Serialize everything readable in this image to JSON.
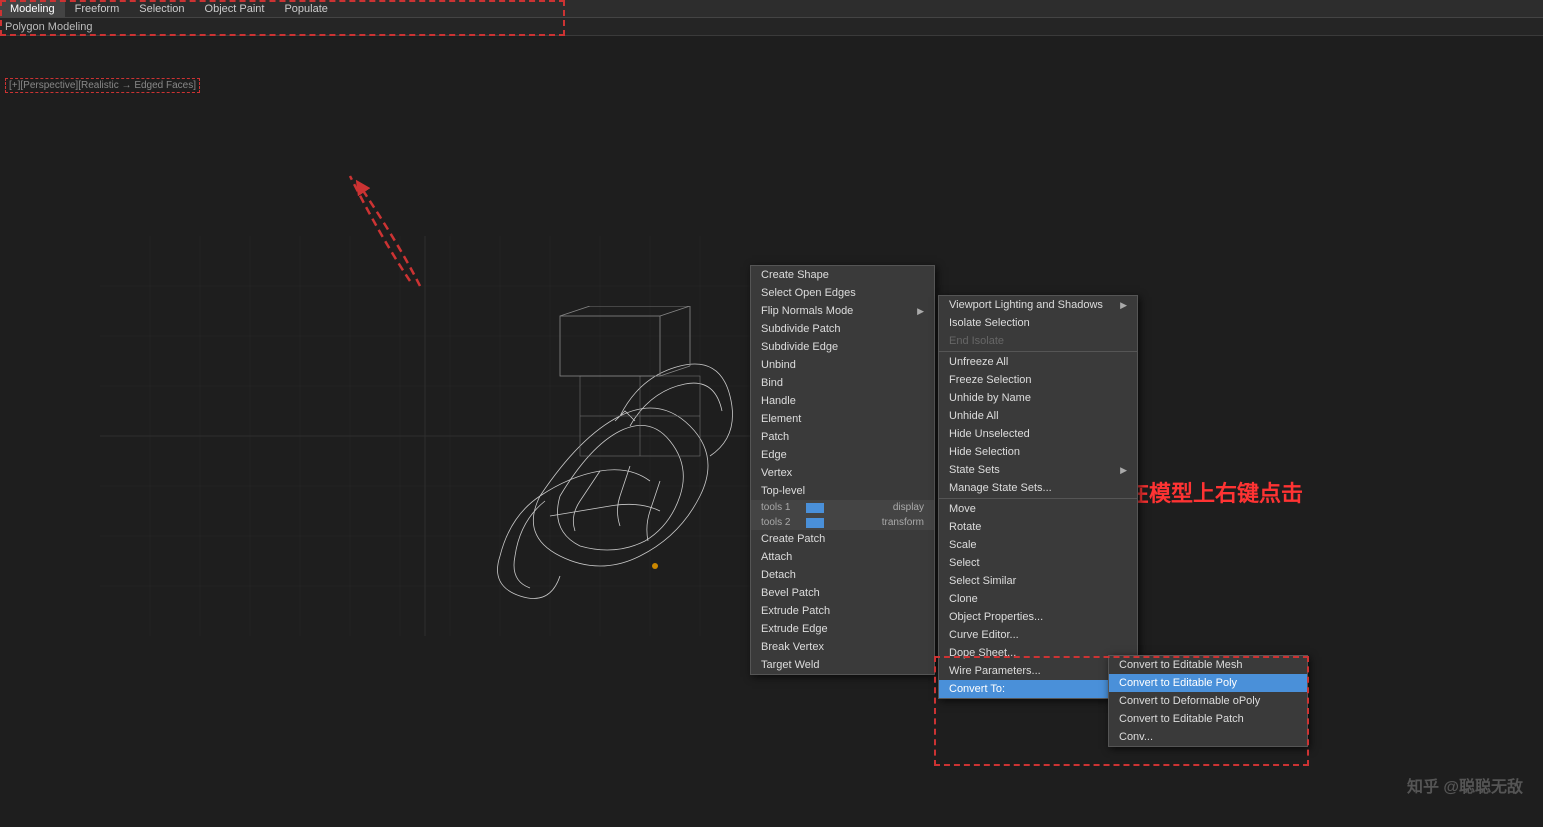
{
  "menubar": {
    "items": [
      "Modeling",
      "Freeform",
      "Selection",
      "Object Paint",
      "Populate"
    ],
    "polygon_label": "Polygon Modeling"
  },
  "viewport": {
    "label": "[+][Perspective][Realistic → Edged Faces]"
  },
  "annotation": {
    "text": "在模型上右键点击"
  },
  "watermark": "知乎 @聪聪无敌",
  "context_menu_left": {
    "items": [
      {
        "label": "Create Shape",
        "disabled": false,
        "arrow": false
      },
      {
        "label": "Select Open Edges",
        "disabled": false,
        "arrow": false
      },
      {
        "label": "Flip Normals Mode",
        "disabled": false,
        "arrow": true
      },
      {
        "label": "Subdivide Patch",
        "disabled": false,
        "arrow": false
      },
      {
        "label": "Subdivide Edge",
        "disabled": false,
        "arrow": false
      },
      {
        "label": "Unbind",
        "disabled": false,
        "arrow": false
      },
      {
        "label": "Bind",
        "disabled": false,
        "arrow": false
      },
      {
        "label": "Handle",
        "disabled": false,
        "arrow": false
      },
      {
        "label": "Element",
        "disabled": false,
        "arrow": false
      },
      {
        "label": "Patch",
        "disabled": false,
        "arrow": false
      },
      {
        "label": "Edge",
        "disabled": false,
        "arrow": false
      },
      {
        "label": "Vertex",
        "disabled": false,
        "arrow": false
      },
      {
        "label": "Top-level",
        "disabled": false,
        "arrow": false
      },
      {
        "label": "tools 1",
        "is_tools": true,
        "arrow": false
      },
      {
        "label": "tools 2",
        "is_tools": true,
        "arrow": false
      },
      {
        "label": "Create Patch",
        "disabled": false,
        "arrow": false
      },
      {
        "label": "Attach",
        "disabled": false,
        "arrow": false
      },
      {
        "label": "Detach",
        "disabled": false,
        "arrow": false
      },
      {
        "label": "Bevel Patch",
        "disabled": false,
        "arrow": false
      },
      {
        "label": "Extrude Patch",
        "disabled": false,
        "arrow": false
      },
      {
        "label": "Extrude Edge",
        "disabled": false,
        "arrow": false
      },
      {
        "label": "Break Vertex",
        "disabled": false,
        "arrow": false
      },
      {
        "label": "Target Weld",
        "disabled": false,
        "arrow": false
      }
    ]
  },
  "context_menu_right": {
    "items": [
      {
        "label": "Viewport Lighting and Shadows",
        "disabled": false,
        "arrow": true
      },
      {
        "label": "Isolate Selection",
        "disabled": false,
        "arrow": false
      },
      {
        "label": "End Isolate",
        "disabled": true,
        "arrow": false
      },
      {
        "label": "Unfreeze All",
        "disabled": false,
        "arrow": false
      },
      {
        "label": "Freeze Selection",
        "disabled": false,
        "arrow": false
      },
      {
        "label": "Unhide by Name",
        "disabled": false,
        "arrow": false
      },
      {
        "label": "Unhide All",
        "disabled": false,
        "arrow": false
      },
      {
        "label": "Hide Unselected",
        "disabled": false,
        "arrow": false
      },
      {
        "label": "Hide Selection",
        "disabled": false,
        "arrow": false
      },
      {
        "label": "State Sets",
        "disabled": false,
        "arrow": true
      },
      {
        "label": "Manage State Sets...",
        "disabled": false,
        "arrow": false
      },
      {
        "label": "separator",
        "is_sep": true
      },
      {
        "label": "Move",
        "disabled": false,
        "arrow": false
      },
      {
        "label": "Rotate",
        "disabled": false,
        "arrow": false
      },
      {
        "label": "Scale",
        "disabled": false,
        "arrow": false
      },
      {
        "label": "Select",
        "disabled": false,
        "arrow": false
      },
      {
        "label": "Select Similar",
        "disabled": false,
        "arrow": false
      },
      {
        "label": "Clone",
        "disabled": false,
        "arrow": false
      },
      {
        "label": "Object Properties...",
        "disabled": false,
        "arrow": false
      },
      {
        "label": "Curve Editor...",
        "disabled": false,
        "arrow": false
      },
      {
        "label": "Dope Sheet...",
        "disabled": false,
        "arrow": false
      },
      {
        "label": "Wire Parameters...",
        "disabled": false,
        "arrow": false
      },
      {
        "label": "Convert To:",
        "disabled": false,
        "arrow": true,
        "highlighted": true
      }
    ]
  },
  "context_menu_convert": {
    "items": [
      {
        "label": "Convert to Editable Mesh",
        "disabled": false,
        "highlighted": false
      },
      {
        "label": "Convert to Editable Poly",
        "disabled": false,
        "highlighted": true
      },
      {
        "label": "Convert to Deformable oPoly",
        "disabled": false,
        "highlighted": false
      },
      {
        "label": "Convert to Editable Patch",
        "disabled": false,
        "highlighted": false
      },
      {
        "label": "Conv...",
        "disabled": false,
        "highlighted": false
      }
    ]
  }
}
